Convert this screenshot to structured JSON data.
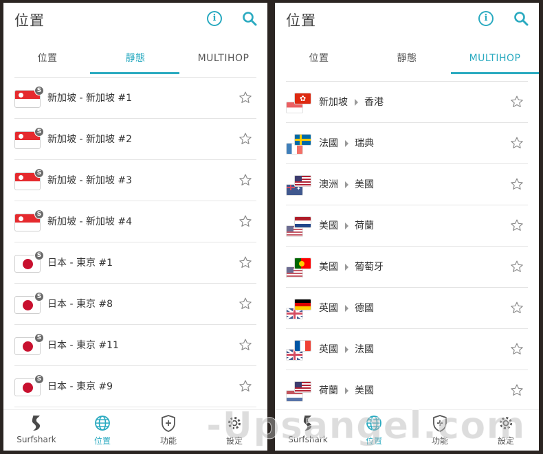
{
  "header": {
    "title": "位置"
  },
  "tabs": [
    "位置",
    "靜態",
    "MULTIHOP"
  ],
  "static_list": [
    {
      "flag": "sg",
      "label": "新加坡 - 新加坡  #1"
    },
    {
      "flag": "sg",
      "label": "新加坡 - 新加坡  #2"
    },
    {
      "flag": "sg",
      "label": "新加坡 - 新加坡  #3"
    },
    {
      "flag": "sg",
      "label": "新加坡 - 新加坡  #4"
    },
    {
      "flag": "jp",
      "label": "日本 - 東京  #1"
    },
    {
      "flag": "jp",
      "label": "日本 - 東京  #8"
    },
    {
      "flag": "jp",
      "label": "日本 - 東京  #11"
    },
    {
      "flag": "jp",
      "label": "日本 - 東京  #9"
    }
  ],
  "static_badge": "S",
  "multihop_list": [
    {
      "from_flag": "sg",
      "to_flag": "hk",
      "from": "新加坡",
      "to": "香港"
    },
    {
      "from_flag": "fr",
      "to_flag": "se",
      "from": "法國",
      "to": "瑞典"
    },
    {
      "from_flag": "au",
      "to_flag": "us",
      "from": "澳洲",
      "to": "美國"
    },
    {
      "from_flag": "us",
      "to_flag": "nl",
      "from": "美國",
      "to": "荷蘭"
    },
    {
      "from_flag": "us",
      "to_flag": "pt",
      "from": "美國",
      "to": "葡萄牙"
    },
    {
      "from_flag": "gb",
      "to_flag": "de",
      "from": "英國",
      "to": "德國"
    },
    {
      "from_flag": "gb",
      "to_flag": "fr",
      "from": "英國",
      "to": "法國"
    },
    {
      "from_flag": "nl",
      "to_flag": "us",
      "from": "荷蘭",
      "to": "美國"
    }
  ],
  "nav": [
    {
      "icon": "surfshark-logo-icon",
      "label": "Surfshark"
    },
    {
      "icon": "globe-icon",
      "label": "位置"
    },
    {
      "icon": "shield-plus-icon",
      "label": "功能"
    },
    {
      "icon": "gear-icon",
      "label": "設定"
    }
  ],
  "watermark": "-Upsangel.com",
  "colors": {
    "accent": "#2aaac0",
    "divider": "#e4e4e4",
    "background": "#2b2522"
  }
}
